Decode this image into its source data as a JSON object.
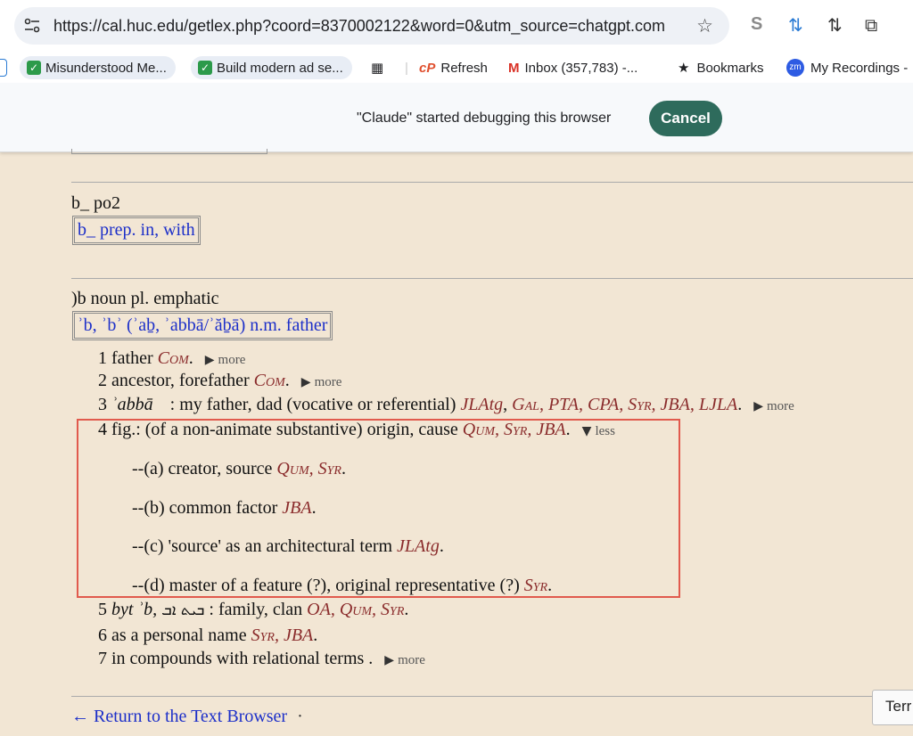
{
  "browser": {
    "url": "https://cal.huc.edu/getlex.php?coord=8370002122&word=0&utm_source=chatgpt.com",
    "bookmarks": [
      "Misunderstood Me...",
      "Build modern ad se...",
      "Refresh",
      "Inbox (357,783) -...",
      "Bookmarks",
      "My Recordings -"
    ],
    "debug_message": "\"Claude\" started debugging this browser",
    "cancel_label": "Cancel"
  },
  "entries": {
    "bpo2_head": "b_ po2",
    "bpo2_link": "b_ prep. in, with",
    "ab_head": ")b noun pl. emphatic",
    "ab_link": "ʾb, ʾbʾ (ʾaḇ, ʾabbā/ʾăḇā) n.m. father"
  },
  "senses": {
    "s1_text": "1 father",
    "s1_abbr": "Com",
    "s2_text": "2 ancestor, forefather",
    "s2_abbr": "Com",
    "s3_num": "3",
    "s3_word": "ʾabbā",
    "s3_text": ": my father, dad (vocative or referential)",
    "s3_abbr1": "JLAtg",
    "s3_abbr2": "Gal, PTA, CPA, Syr, JBA, LJLA",
    "s4_text": "4 fig.: (of a non-animate substantive) origin, cause",
    "s4_abbr": "Qum, Syr, JBA",
    "s4a_text": "--(a) creator, source",
    "s4a_abbr": "Qum, Syr",
    "s4b_text": "--(b) common factor",
    "s4b_abbr": "JBA",
    "s4c_text": "--(c) 'source' as an architectural term",
    "s4c_abbr": "JLAtg",
    "s4d_text": "--(d) master of a feature (?), original representative (?)",
    "s4d_abbr": "Syr",
    "s5_num": "5",
    "s5_word": "byt ʾb,",
    "s5_syriac": "ܒܝܬ ܐܒ",
    "s5_text": ": family, clan",
    "s5_abbr": "OA, Qum, Syr",
    "s6_text": "6 as a personal name",
    "s6_abbr": "Syr, JBA",
    "s7_text": "7 in compounds with relational terms ."
  },
  "ui": {
    "more_label": "more",
    "less_label": "less",
    "return_label": "← Return to the Text Browser",
    "return_dot": "·",
    "terr_label": "Terr"
  }
}
